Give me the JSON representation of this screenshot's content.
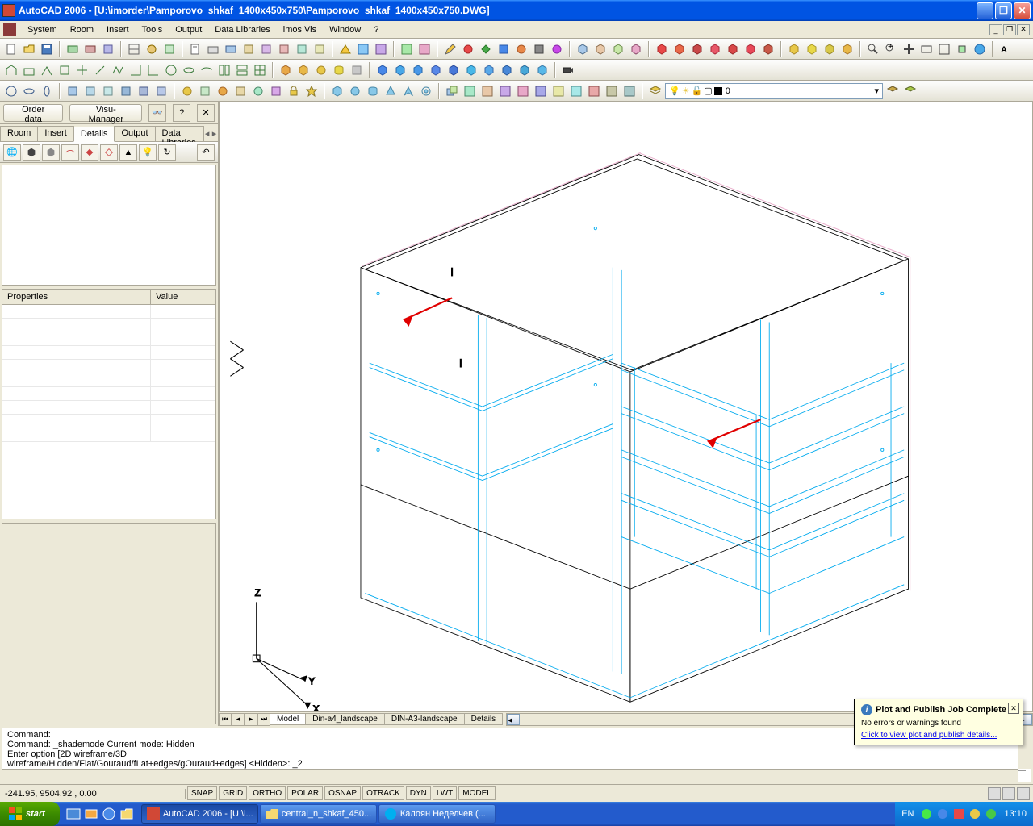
{
  "title": "AutoCAD 2006 - [U:\\imorder\\Pamporovo_shkaf_1400x450x750\\Pamporovo_shkaf_1400x450x750.DWG]",
  "menu": [
    "System",
    "Room",
    "Insert",
    "Tools",
    "Output",
    "Data Libraries",
    "imos Vis",
    "Window",
    "?"
  ],
  "left_panel": {
    "order_btn": "Order data",
    "visu_btn": "Visu-Manager",
    "tabs": [
      "Room",
      "Insert",
      "Details",
      "Output",
      "Data Libraries"
    ],
    "active_tab": "Details",
    "props_headers": [
      "Properties",
      "Value",
      ""
    ]
  },
  "layer_combo": "0",
  "canvas_tabs": {
    "items": [
      "Model",
      "Din-a4_landscape",
      "DIN-A3-landscape",
      "Details"
    ],
    "active": "Model"
  },
  "command": {
    "lines": [
      "Command:",
      "Command: _shademode Current mode: Hidden",
      "Enter option [2D wireframe/3D",
      "wireframe/Hidden/Flat/Gouraud/fLat+edges/gOuraud+edges] <Hidden>: _2"
    ],
    "prompt": "Command:"
  },
  "notification": {
    "title": "Plot and Publish Job Complete",
    "body": "No errors or warnings found",
    "link": "Click to view plot and publish details..."
  },
  "status": {
    "coords": "-241.95, 9504.92 , 0.00",
    "toggles": [
      "SNAP",
      "GRID",
      "ORTHO",
      "POLAR",
      "OSNAP",
      "OTRACK",
      "DYN",
      "LWT",
      "MODEL"
    ]
  },
  "taskbar": {
    "start": "start",
    "tasks": [
      {
        "label": "AutoCAD 2006 - [U:\\i...",
        "active": true
      },
      {
        "label": "central_n_shkaf_450...",
        "active": false
      },
      {
        "label": "Калоян Неделчев (...",
        "active": false
      }
    ],
    "lang": "EN",
    "time": "13:10"
  },
  "axis_labels": {
    "x": "X",
    "y": "Y",
    "z": "Z"
  }
}
